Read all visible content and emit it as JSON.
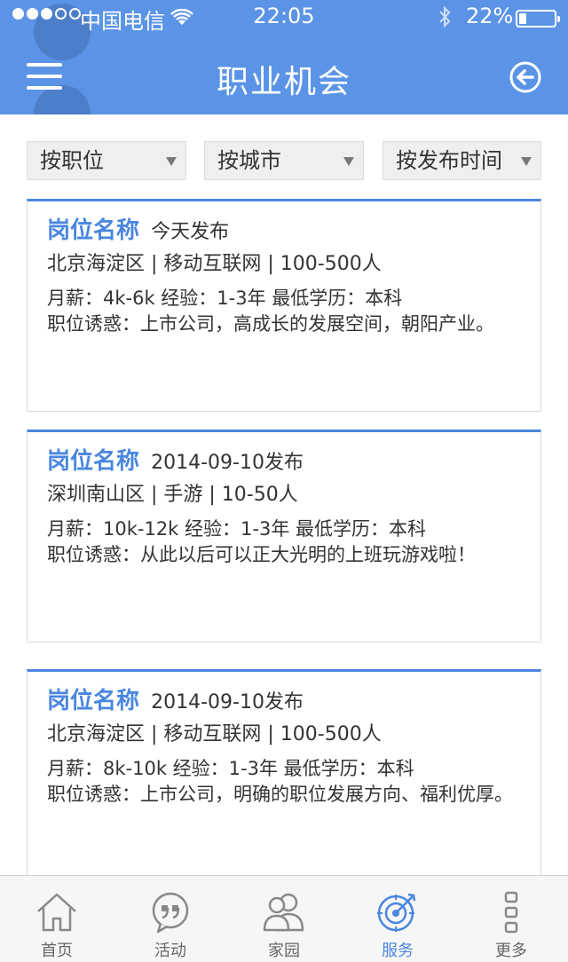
{
  "statusbar": {
    "carrier": "中国电信",
    "time": "22:05",
    "battery_pct": "22%",
    "battery_level": 0.22
  },
  "header": {
    "title": "职业机会",
    "menu_icon": "hamburger-icon",
    "back_icon": "circle-arrow-left-icon",
    "bg_color": "#5b94e6"
  },
  "filters": [
    {
      "label": "按职位"
    },
    {
      "label": "按城市"
    },
    {
      "label": "按发布时间"
    }
  ],
  "jobs": [
    {
      "title": "岗位名称",
      "date": "今天发布",
      "company": "北京海淀区 | 移动互联网 | 100-500人",
      "salary": "月薪：4k-6k 经验：1-3年 最低学历：本科",
      "perk": "职位诱惑：上市公司，高成长的发展空间，朝阳产业。"
    },
    {
      "title": "岗位名称",
      "date": "2014-09-10发布",
      "company": "深圳南山区 | 手游 | 10-50人",
      "salary": "月薪：10k-12k 经验：1-3年 最低学历：本科",
      "perk": "职位诱惑：从此以后可以正大光明的上班玩游戏啦！"
    },
    {
      "title": "岗位名称",
      "date": "2014-09-10发布",
      "company": "北京海淀区 | 移动互联网 | 100-500人",
      "salary": "月薪：8k-10k 经验：1-3年 最低学历：本科",
      "perk": "职位诱惑：上市公司，明确的职位发展方向、福利优厚。"
    }
  ],
  "tabbar": {
    "active": "服务",
    "accent": "#4a86e0",
    "items": [
      {
        "label": "首页",
        "icon": "home-icon"
      },
      {
        "label": "活动",
        "icon": "quote-bubble-icon"
      },
      {
        "label": "家园",
        "icon": "people-icon"
      },
      {
        "label": "服务",
        "icon": "target-icon"
      },
      {
        "label": "更多",
        "icon": "more-icon"
      }
    ]
  }
}
